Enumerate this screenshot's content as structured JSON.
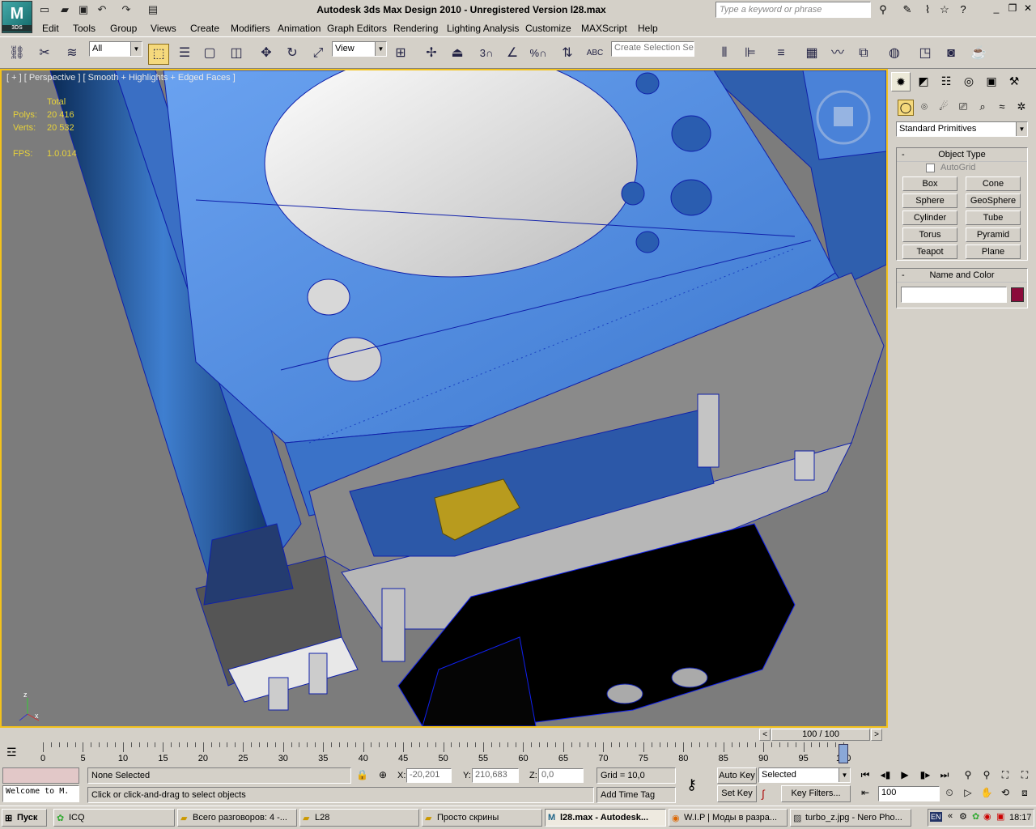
{
  "window": {
    "title": "Autodesk 3ds Max Design 2010  - Unregistered Version     l28.max",
    "logo": "3DS",
    "search_placeholder": "Type a keyword or phrase"
  },
  "menu": [
    "Edit",
    "Tools",
    "Group",
    "Views",
    "Create",
    "Modifiers",
    "Animation",
    "Graph Editors",
    "Rendering",
    "Lighting Analysis",
    "Customize",
    "MAXScript",
    "Help"
  ],
  "toolbar": {
    "selection_filter": "All",
    "ref_coord": "View",
    "named_selection_placeholder": "Create Selection Se",
    "snap_label": "3",
    "percent_snap_label": "%"
  },
  "viewport": {
    "label": "[ + ] [ Perspective ] [ Smooth + Highlights + Edged Faces ]",
    "stats_header": "Total",
    "polys_label": "Polys:",
    "polys_value": "20 416",
    "verts_label": "Verts:",
    "verts_value": "20 532",
    "fps_label": "FPS:",
    "fps_value": "1.0.014",
    "axis_x": "x",
    "axis_z": "z"
  },
  "command_panel": {
    "dropdown": "Standard Primitives",
    "object_type_title": "Object Type",
    "autogrid_label": "AutoGrid",
    "buttons": [
      "Box",
      "Cone",
      "Sphere",
      "GeoSphere",
      "Cylinder",
      "Tube",
      "Torus",
      "Pyramid",
      "Teapot",
      "Plane"
    ],
    "name_color_title": "Name and Color",
    "name_value": "",
    "swatch_color": "#8b0a3a",
    "rollout_minus": "-"
  },
  "timeline": {
    "frame_display": "100 / 100",
    "ticks": [
      "0",
      "5",
      "10",
      "15",
      "20",
      "25",
      "30",
      "35",
      "40",
      "45",
      "50",
      "55",
      "60",
      "65",
      "70",
      "75",
      "80",
      "85",
      "90",
      "95",
      "100"
    ],
    "current_frame": 100,
    "total_frames": 100
  },
  "status": {
    "maxscript": "Welcome to M.",
    "selection": "None Selected",
    "prompt": "Click or click-and-drag to select objects",
    "x_label": "X:",
    "x_value": "-20,201",
    "y_label": "Y:",
    "y_value": "210,683",
    "z_label": "Z:",
    "z_value": "0,0",
    "grid": "Grid = 10,0",
    "add_time_tag": "Add Time Tag",
    "auto_key": "Auto Key",
    "set_key": "Set Key",
    "key_mode": "Selected",
    "key_filters": "Key Filters...",
    "frame_field": "100"
  },
  "taskbar": {
    "start": "Пуск",
    "tasks": [
      "ICQ",
      "Всего разговоров: 4 -...",
      "L28",
      "Просто скрины",
      "l28.max - Autodesk...",
      "W.I.P | Моды в разра...",
      "turbo_z.jpg - Nero Pho..."
    ],
    "lang": "EN",
    "clock": "18:17"
  }
}
